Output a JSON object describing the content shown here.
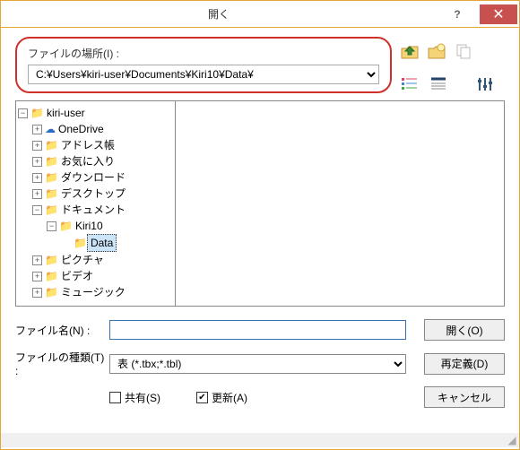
{
  "title": "開く",
  "path_label": "ファイルの場所(I) :",
  "path_value": "C:¥Users¥kiri-user¥Documents¥Kiri10¥Data¥",
  "tree": {
    "root": "kiri-user",
    "items": [
      {
        "label": "OneDrive",
        "icon": "cloud"
      },
      {
        "label": "アドレス帳",
        "icon": "folder"
      },
      {
        "label": "お気に入り",
        "icon": "folder"
      },
      {
        "label": "ダウンロード",
        "icon": "folder"
      },
      {
        "label": "デスクトップ",
        "icon": "folder"
      },
      {
        "label": "ドキュメント",
        "icon": "folder",
        "expanded": true,
        "children": [
          {
            "label": "Kiri10",
            "icon": "folder",
            "expanded": true,
            "children": [
              {
                "label": "Data",
                "icon": "folder",
                "selected": true
              }
            ]
          }
        ]
      },
      {
        "label": "ピクチャ",
        "icon": "folder"
      },
      {
        "label": "ビデオ",
        "icon": "folder"
      },
      {
        "label": "ミュージック",
        "icon": "folder"
      }
    ]
  },
  "filename_label": "ファイル名(N) :",
  "filename_value": "",
  "filetype_label": "ファイルの種類(T) :",
  "filetype_value": "表 (*.tbx;*.tbl)",
  "share_label": "共有(S)",
  "share_checked": false,
  "update_label": "更新(A)",
  "update_checked": true,
  "buttons": {
    "open": "開く(O)",
    "redef": "再定義(D)",
    "cancel": "キャンセル"
  },
  "icon_names": {
    "up": "up-folder",
    "new": "new-folder",
    "details": "details-view",
    "list": "list-view",
    "settings": "settings"
  }
}
